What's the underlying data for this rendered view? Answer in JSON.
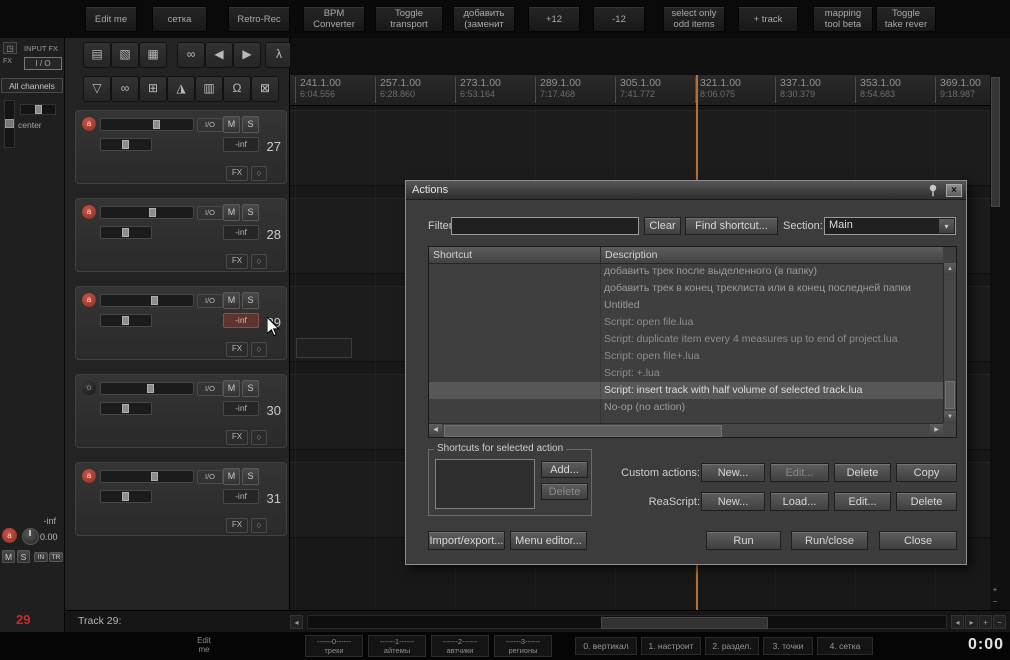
{
  "colors": {
    "accent_red": "#b5332a",
    "playhead": "#bd6f2b",
    "selection": "#575757"
  },
  "top_toolbar": {
    "buttons": [
      {
        "l1": "Edit me",
        "l2": ""
      },
      {
        "l1": "сетка",
        "l2": ""
      },
      {
        "l1": "Retro-Rec",
        "l2": ""
      },
      {
        "l1": "BPM",
        "l2": "Converter"
      },
      {
        "l1": "Toggle",
        "l2": "transport"
      },
      {
        "l1": "добавить",
        "l2": "(заменит"
      },
      {
        "l1": "+12",
        "l2": ""
      },
      {
        "l1": "-12",
        "l2": ""
      },
      {
        "l1": "select only",
        "l2": "odd items"
      },
      {
        "l1": "+ track",
        "l2": ""
      },
      {
        "l1": "mapping",
        "l2": "tool beta"
      },
      {
        "l1": "Toggle",
        "l2": "take rever"
      }
    ]
  },
  "left_rail": {
    "mon_icon": "◳",
    "fx_label": "FX",
    "input_fx": "INPUT FX",
    "io": "I / O",
    "all_channels": "All channels",
    "pan_label": "center"
  },
  "tcp_toolbar": {
    "row1": [
      "▤",
      "▧",
      "▦",
      "∞",
      "◀",
      "▶",
      "λ"
    ],
    "row2": [
      "▽",
      "∞",
      "⊞",
      "◮",
      "▥",
      "Ω",
      "⊠"
    ]
  },
  "track_labels": {
    "io": "I/O",
    "mute": "M",
    "solo": "S",
    "fx": "FX"
  },
  "tracks": [
    {
      "num": "27",
      "rec": "a",
      "vol": "-inf"
    },
    {
      "num": "28",
      "rec": "a",
      "vol": "-inf"
    },
    {
      "num": "29",
      "rec": "a",
      "vol": "-inf"
    },
    {
      "num": "30",
      "rec": "o",
      "vol": "-inf"
    },
    {
      "num": "31",
      "rec": "a",
      "vol": "-inf"
    }
  ],
  "ruler": {
    "marks": [
      {
        "bar": "241.1.00",
        "time": "6:04.556"
      },
      {
        "bar": "257.1.00",
        "time": "6:28.860"
      },
      {
        "bar": "273.1.00",
        "time": "6:53.164"
      },
      {
        "bar": "289.1.00",
        "time": "7:17.468"
      },
      {
        "bar": "305.1.00",
        "time": "7:41.772"
      },
      {
        "bar": "321.1.00",
        "time": "8:06.075"
      },
      {
        "bar": "337.1.00",
        "time": "8:30.379"
      },
      {
        "bar": "353.1.00",
        "time": "8:54.683"
      },
      {
        "bar": "369.1.00",
        "time": "9:18.987"
      }
    ]
  },
  "master": {
    "vol": "-inf",
    "rec": "a",
    "pan_value": "0.00",
    "mute": "M",
    "solo": "S",
    "in_label": "IN",
    "tr_label": "TR",
    "track_num": "29"
  },
  "status_bar": {
    "track_label": "Track 29:"
  },
  "dialog": {
    "title": "Actions",
    "filter_label": "Filter:",
    "filter_value": "",
    "clear": "Clear",
    "find_shortcut": "Find shortcut...",
    "section_label": "Section:",
    "section_value": "Main",
    "col_shortcut": "Shortcut",
    "col_description": "Description",
    "rows": [
      {
        "desc": "добавить трек после выделенного (в папку)",
        "state": "normal"
      },
      {
        "desc": "добавить трек в конец треклиста или в конец последней папки",
        "state": "normal"
      },
      {
        "desc": "Untitled",
        "state": "normal"
      },
      {
        "desc": "Script: open file.lua",
        "state": "dim"
      },
      {
        "desc": "Script: duplicate item every 4 measures up to end of project.lua",
        "state": "dim"
      },
      {
        "desc": "Script: open file+.lua",
        "state": "dim"
      },
      {
        "desc": "Script: +.lua",
        "state": "dim"
      },
      {
        "desc": "Script: insert track with half volume of selected track.lua",
        "state": "selected"
      },
      {
        "desc": "No-op (no action)",
        "state": "normal"
      }
    ],
    "group_title": "Shortcuts for selected action",
    "add": "Add...",
    "delete": "Delete",
    "custom_actions_label": "Custom actions:",
    "custom_buttons": [
      "New...",
      "Edit...",
      "Delete",
      "Copy"
    ],
    "reascript_label": "ReaScript:",
    "reascript_buttons": [
      "New...",
      "Load...",
      "Edit...",
      "Delete"
    ],
    "import_export": "Import/export...",
    "menu_editor": "Menu editor...",
    "run": "Run",
    "run_close": "Run/close",
    "close_btn": "Close"
  },
  "bottom_toolbar": {
    "edit": {
      "l1": "Edit",
      "l2": "me"
    },
    "group_buttons": [
      {
        "l1": "------0------",
        "l2": "треки"
      },
      {
        "l1": "------1------",
        "l2": "айтемы"
      },
      {
        "l1": "------2------",
        "l2": "автчики"
      },
      {
        "l1": "------3------",
        "l2": "регионы"
      }
    ],
    "num_buttons": [
      "0. вертикал",
      "1. настроит",
      "2. раздел.",
      "3. точки",
      "4. сетка"
    ],
    "time": "0:00"
  },
  "icons": {
    "scroll_left": "◂",
    "scroll_right": "▸",
    "plus": "+",
    "minus": "−",
    "up": "▲",
    "down": "▼",
    "left": "◀",
    "right": "▶",
    "dropdown": "▾",
    "close": "×",
    "power": "○"
  }
}
